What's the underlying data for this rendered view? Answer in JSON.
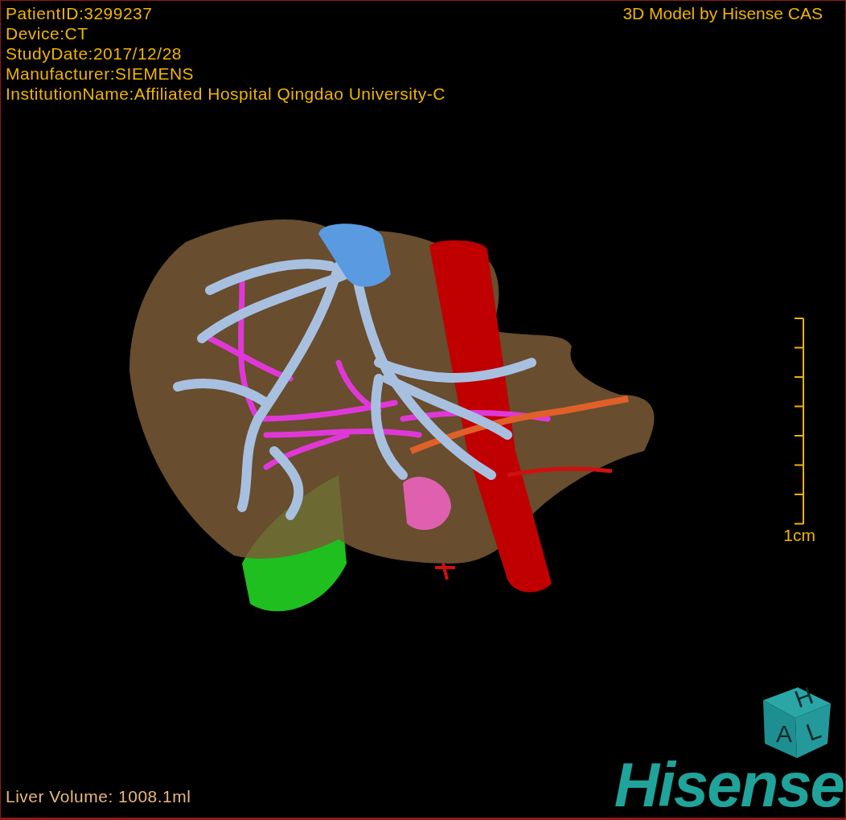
{
  "info_lines": [
    "PatientID:3299237",
    "Device:CT",
    "StudyDate:2017/12/28",
    "Manufacturer:SIEMENS",
    "InstitutionName:Affiliated Hospital Qingdao University-C"
  ],
  "credit": "3D Model by Hisense CAS",
  "scale": {
    "label": "1cm"
  },
  "orientation_cube": {
    "faces": [
      "H",
      "A",
      "L"
    ]
  },
  "logo": "Hisense",
  "volume": "Liver Volume: 1008.1ml"
}
